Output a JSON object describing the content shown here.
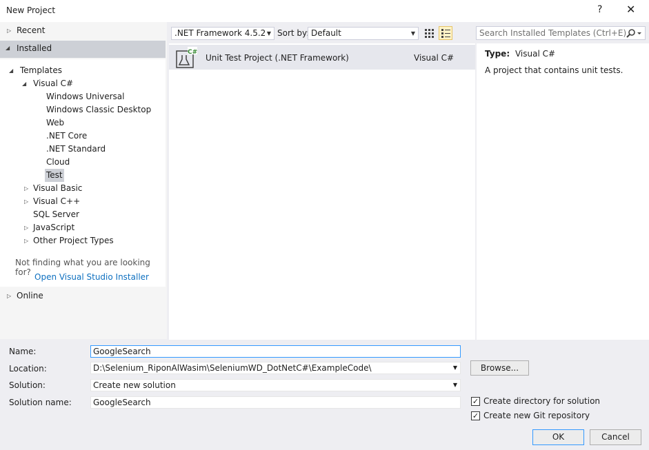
{
  "window": {
    "title": "New Project",
    "help": "?",
    "close": "✕"
  },
  "left": {
    "recent": "Recent",
    "installed": "Installed",
    "templates": "Templates",
    "visual_csharp": "Visual C#",
    "csharp_children": [
      "Windows Universal",
      "Windows Classic Desktop",
      "Web",
      ".NET Core",
      ".NET Standard",
      "Cloud",
      "Test"
    ],
    "others": [
      "Visual Basic",
      "Visual C++",
      "SQL Server",
      "JavaScript",
      "Other Project Types"
    ],
    "not_finding": "Not finding what you are looking for?",
    "installer_link": "Open Visual Studio Installer",
    "online": "Online"
  },
  "toolbar": {
    "framework": ".NET Framework 4.5.2",
    "sort_label": "Sort by:",
    "sort_value": "Default",
    "search_placeholder": "Search Installed Templates (Ctrl+E)"
  },
  "templates": [
    {
      "name": "Unit Test Project (.NET Framework)",
      "language": "Visual C#"
    }
  ],
  "details": {
    "type_label": "Type:",
    "type_value": "Visual C#",
    "description": "A project that contains unit tests."
  },
  "form": {
    "name_label": "Name:",
    "name_value": "GoogleSearch",
    "location_label": "Location:",
    "location_value": "D:\\Selenium_RiponAlWasim\\SeleniumWD_DotNetC#\\ExampleCode\\",
    "solution_label": "Solution:",
    "solution_value": "Create new solution",
    "solution_name_label": "Solution name:",
    "solution_name_value": "GoogleSearch",
    "browse": "Browse...",
    "create_dir": "Create directory for solution",
    "create_git": "Create new Git repository",
    "ok": "OK",
    "cancel": "Cancel"
  },
  "colors": {
    "accent": "#0e70c0",
    "selection": "#cdd0d6",
    "focus_border": "#3399ff",
    "csharp_badge": "#388a34"
  }
}
